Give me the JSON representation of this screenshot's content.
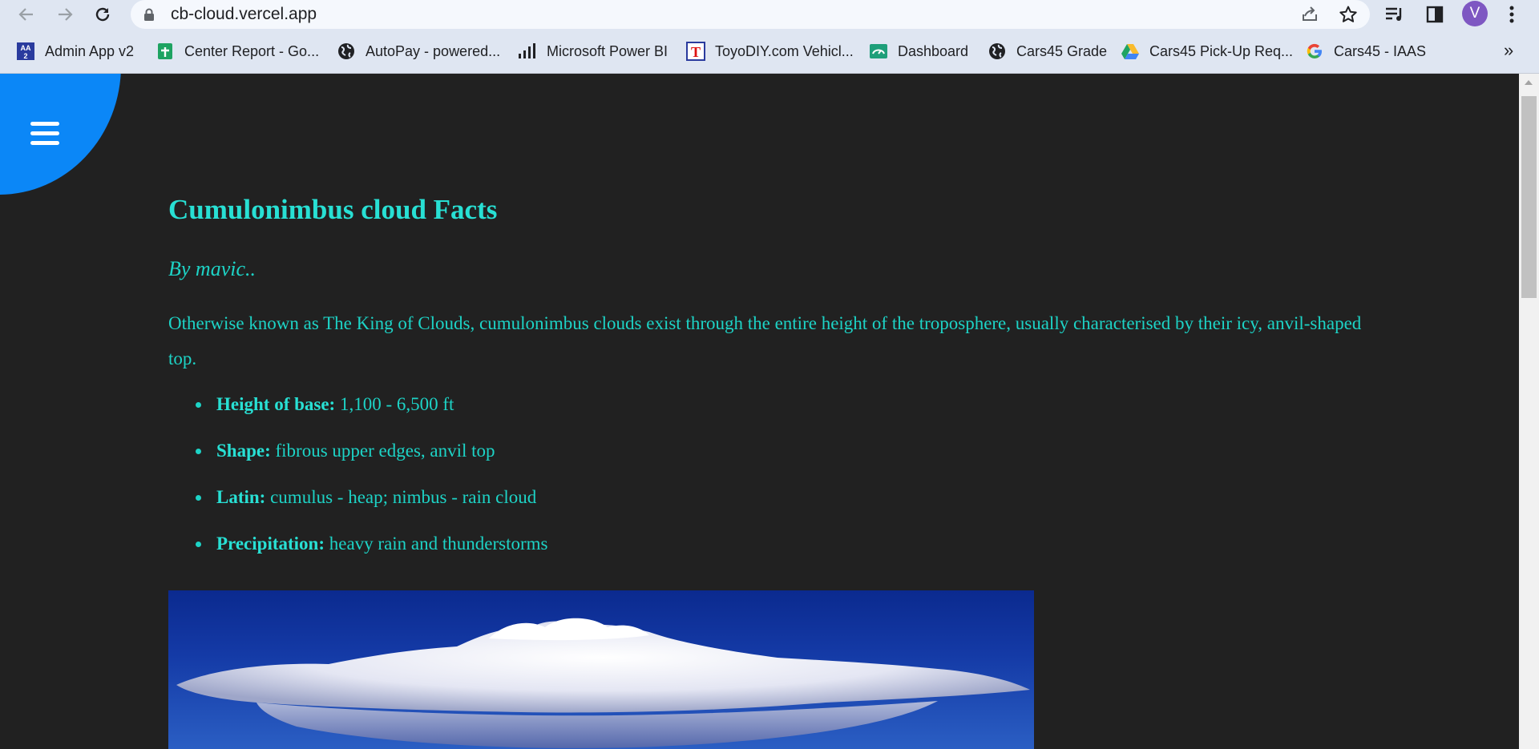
{
  "browser": {
    "url": "cb-cloud.vercel.app",
    "profile_initial": "V",
    "bookmarks": [
      {
        "label": "Admin App v2",
        "icon": "admin-app-icon"
      },
      {
        "label": "Center Report - Go...",
        "icon": "google-sheets-icon"
      },
      {
        "label": "AutoPay - powered...",
        "icon": "globe-icon"
      },
      {
        "label": "Microsoft Power BI",
        "icon": "power-bi-icon"
      },
      {
        "label": "ToyoDIY.com Vehicl...",
        "icon": "toyodiy-icon"
      },
      {
        "label": "Dashboard",
        "icon": "dashboard-icon"
      },
      {
        "label": "Cars45 Grade",
        "icon": "globe-icon"
      },
      {
        "label": "Cars45 Pick-Up Req...",
        "icon": "google-drive-icon"
      },
      {
        "label": "Cars45 - IAAS",
        "icon": "google-icon"
      }
    ],
    "more_bookmarks": "»"
  },
  "page": {
    "title": "Cumulonimbus cloud Facts",
    "byline": "By mavic..",
    "intro": "Otherwise known as The King of Clouds, cumulonimbus clouds exist through the entire height of the troposphere, usually characterised by their icy, anvil-shaped top.",
    "facts": [
      {
        "key": "Height of base:",
        "value": " 1,100 - 6,500 ft"
      },
      {
        "key": "Shape:",
        "value": " fibrous upper edges, anvil top"
      },
      {
        "key": "Latin:",
        "value": " cumulus - heap; nimbus - rain cloud"
      },
      {
        "key": "Precipitation:",
        "value": " heavy rain and thunderstorms"
      }
    ]
  },
  "colors": {
    "accent": "#1dd3c6",
    "menu_bubble": "#0b87f7",
    "background": "#212121"
  }
}
